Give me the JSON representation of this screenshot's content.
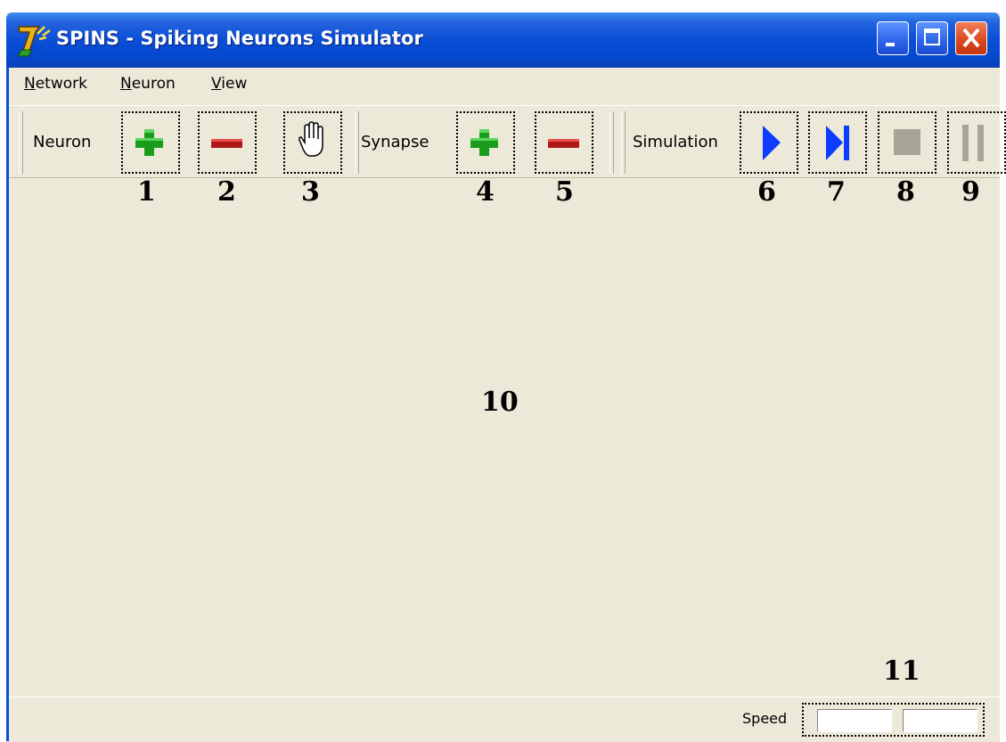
{
  "window": {
    "title": "SPINS - Spiking Neurons Simulator"
  },
  "menu": {
    "items": [
      "Network",
      "Neuron",
      "View"
    ]
  },
  "toolbar": {
    "neuron_label": "Neuron",
    "synapse_label": "Synapse",
    "simulation_label": "Simulation",
    "buttons": [
      {
        "icon": "plus-icon",
        "color": "#1a9b1a"
      },
      {
        "icon": "minus-icon",
        "color": "#b01818"
      },
      {
        "icon": "hand-icon"
      },
      {
        "icon": "plus-icon",
        "color": "#1a9b1a"
      },
      {
        "icon": "minus-icon",
        "color": "#b01818"
      },
      {
        "icon": "play-icon",
        "color": "#0b3cff"
      },
      {
        "icon": "step-icon",
        "color": "#0b3cff"
      },
      {
        "icon": "stop-icon",
        "color": "#a8a497"
      },
      {
        "icon": "pause-icon",
        "color": "#a8a497"
      }
    ]
  },
  "annotations": [
    "1",
    "2",
    "3",
    "4",
    "5",
    "6",
    "7",
    "8",
    "9",
    "10",
    "11"
  ],
  "statusbar": {
    "speed_label": "Speed"
  }
}
